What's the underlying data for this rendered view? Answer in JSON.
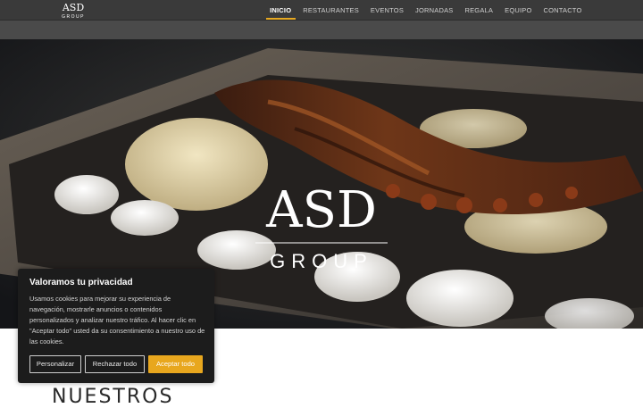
{
  "header": {
    "logo_text": "ASD",
    "logo_subtext": "GROUP",
    "nav": [
      {
        "label": "INICIO",
        "active": true
      },
      {
        "label": "RESTAURANTES",
        "active": false
      },
      {
        "label": "EVENTOS",
        "active": false
      },
      {
        "label": "JORNADAS",
        "active": false
      },
      {
        "label": "REGALA",
        "active": false
      },
      {
        "label": "EQUIPO",
        "active": false
      },
      {
        "label": "CONTACTO",
        "active": false
      }
    ]
  },
  "hero": {
    "logo_text": "ASD",
    "logo_subtext": "GROUP",
    "image_subject": "grilled octopus dish"
  },
  "main": {
    "section_heading": "NUESTROS"
  },
  "cookie_banner": {
    "title": "Valoramos tu privacidad",
    "text": "Usamos cookies para mejorar su experiencia de navegación, mostrarle anuncios o contenidos personalizados y analizar nuestro tráfico. Al hacer clic en \"Aceptar todo\" usted da su consentimiento a nuestro uso de las cookies.",
    "customize_label": "Personalizar",
    "reject_label": "Rechazar todo",
    "accept_label": "Aceptar todo"
  },
  "colors": {
    "accent": "#e8a71e",
    "nav_bg": "#3a3a3a",
    "banner_bg": "#1c1c1c"
  }
}
